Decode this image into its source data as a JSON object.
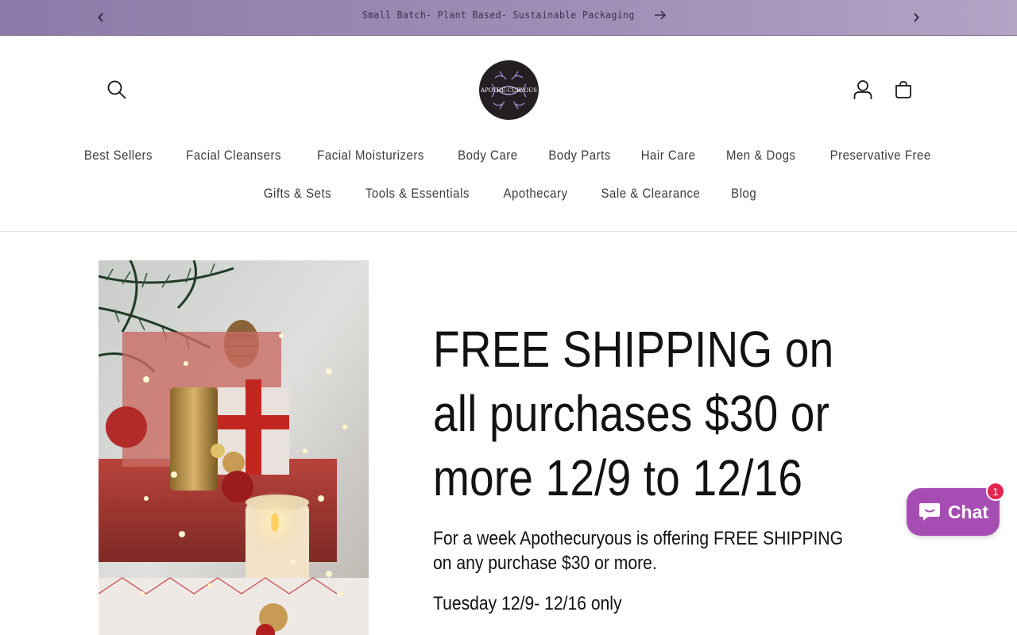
{
  "announcement": {
    "text": "Small Batch- Plant Based- Sustainable Packaging",
    "prev_icon": "chevron-left-icon",
    "next_icon": "chevron-right-icon",
    "arrow_icon": "arrow-right-icon",
    "background": "#9d8cb5"
  },
  "header": {
    "logo_text": "APOTHE·CURYOUS",
    "search_icon": "search-icon",
    "account_icon": "account-icon",
    "cart_icon": "cart-icon"
  },
  "nav": {
    "row1": [
      "Best Sellers",
      "Facial Cleansers",
      "Facial Moisturizers",
      "Body Care",
      "Body Parts",
      "Hair Care",
      "Men & Dogs",
      "Preservative Free"
    ],
    "row2": [
      "Gifts & Sets",
      "Tools & Essentials",
      "Apothecary",
      "Sale & Clearance",
      "Blog"
    ]
  },
  "hero": {
    "title": "FREE SHIPPING on all purchases $30 or more 12/9 to 12/16",
    "body": "For a week Apothecuryous is offering FREE SHIPPING on any purchase $30 or more.",
    "date": "Tuesday 12/9- 12/16 only"
  },
  "chat": {
    "label": "Chat",
    "badge_count": "1",
    "color": "#a64db4"
  }
}
